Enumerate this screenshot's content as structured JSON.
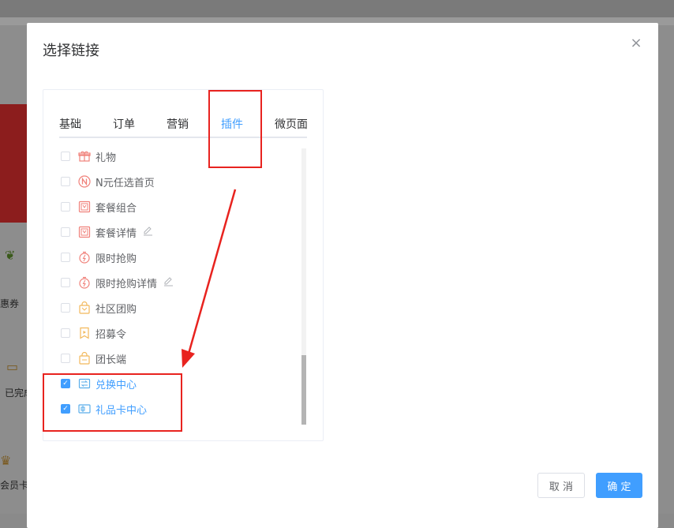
{
  "background": {
    "labels": [
      "惠券",
      "已完成",
      "会员卡"
    ]
  },
  "dialog": {
    "title": "选择链接",
    "close_symbol": "×",
    "tabs": [
      {
        "label": "基础",
        "active": false
      },
      {
        "label": "订单",
        "active": false
      },
      {
        "label": "营销",
        "active": false
      },
      {
        "label": "插件",
        "active": true
      },
      {
        "label": "微页面",
        "active": false
      }
    ],
    "items": [
      {
        "label": "礼物",
        "icon": "gift-icon",
        "checked": false,
        "editable": false
      },
      {
        "label": "N元任选首页",
        "icon": "n-circle-icon",
        "checked": false,
        "editable": false
      },
      {
        "label": "套餐组合",
        "icon": "package-icon",
        "checked": false,
        "editable": false
      },
      {
        "label": "套餐详情",
        "icon": "package-icon",
        "checked": false,
        "editable": true
      },
      {
        "label": "限时抢购",
        "icon": "stopwatch-icon",
        "checked": false,
        "editable": false
      },
      {
        "label": "限时抢购详情",
        "icon": "stopwatch-icon",
        "checked": false,
        "editable": true
      },
      {
        "label": "社区团购",
        "icon": "shopping-bag-icon",
        "checked": false,
        "editable": false
      },
      {
        "label": "招募令",
        "icon": "banner-icon",
        "checked": false,
        "editable": false
      },
      {
        "label": "团长端",
        "icon": "bag-icon",
        "checked": false,
        "editable": false
      },
      {
        "label": "兑换中心",
        "icon": "exchange-icon",
        "checked": true,
        "editable": false
      },
      {
        "label": "礼品卡中心",
        "icon": "gift-card-icon",
        "checked": true,
        "editable": false
      }
    ],
    "cancel_label": "取 消",
    "confirm_label": "确 定"
  },
  "colors": {
    "accent": "#409eff",
    "annotation": "#e8231f",
    "icon_red": "#f0817a",
    "icon_orange": "#f2b85a"
  }
}
